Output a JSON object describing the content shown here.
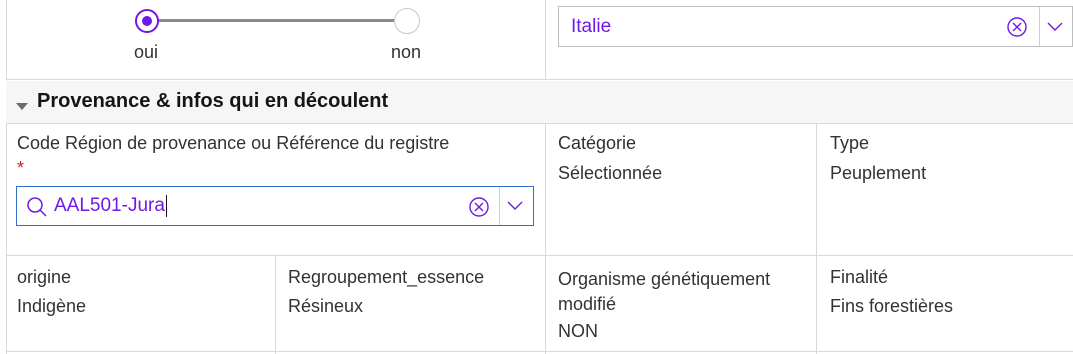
{
  "top": {
    "radio_yes": "oui",
    "radio_no": "non",
    "country_value": "Italie",
    "selected_option": "oui"
  },
  "section": {
    "title": "Provenance & infos qui en découlent"
  },
  "provenance": {
    "label": "Code Région de provenance ou Référence du registre",
    "required_mark": "*",
    "input_value": "AAL501-Jura"
  },
  "categorie": {
    "label": "Catégorie",
    "value": "Sélectionnée"
  },
  "type": {
    "label": "Type",
    "value": "Peuplement"
  },
  "origine": {
    "label": "origine",
    "value": "Indigène"
  },
  "regroupement": {
    "label": "Regroupement_essence",
    "value": "Résineux"
  },
  "ogm": {
    "label": "Organisme génétiquement modifié",
    "value": "NON"
  },
  "finalite": {
    "label": "Finalité",
    "value": "Fins forestières"
  },
  "colors": {
    "accent": "#6f19e6",
    "focus": "#2f6fc4",
    "required": "#c62828"
  }
}
